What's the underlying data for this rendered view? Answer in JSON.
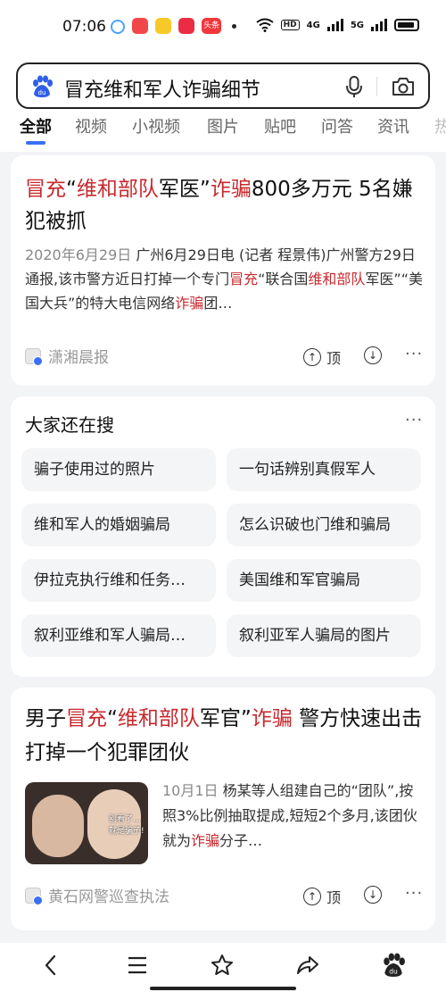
{
  "status": {
    "time": "07:06",
    "app5": "头条",
    "network": "4G",
    "network2": "5G",
    "hd": "HD"
  },
  "search": {
    "query": "冒充维和军人诈骗细节"
  },
  "tabs": [
    "全部",
    "视频",
    "小视频",
    "图片",
    "贴吧",
    "问答",
    "资讯",
    "热"
  ],
  "result1": {
    "title": [
      {
        "t": "冒充",
        "r": true
      },
      {
        "t": "“"
      },
      {
        "t": "维和部队",
        "r": true
      },
      {
        "t": "军医”"
      },
      {
        "t": "诈骗",
        "r": true
      },
      {
        "t": "800多万元 5名嫌犯被抓"
      }
    ],
    "date": "2020年6月29日",
    "snippet": [
      {
        "t": "  广州6月29日电 (记者 程景伟)广州警方29日通报,该市警方近日打掉一个专门"
      },
      {
        "t": "冒充",
        "r": true
      },
      {
        "t": "“联合国"
      },
      {
        "t": "维和部队",
        "r": true
      },
      {
        "t": "军医”“美国大兵”的特大电信网络"
      },
      {
        "t": "诈骗",
        "r": true
      },
      {
        "t": "团…"
      }
    ],
    "source": "潇湘晨报",
    "top_label": "顶",
    "more": "···"
  },
  "people_search": {
    "title": "大家还在搜",
    "more": "···",
    "items": [
      "骗子使用过的照片",
      "一句话辨别真假军人",
      "维和军人的婚姻骗局",
      "怎么识破也门维和骗局",
      "伊拉克执行维和任务…",
      "美国维和军官骗局",
      "叙利亚维和军人骗局…",
      "叙利亚军人骗局的图片"
    ]
  },
  "result2": {
    "title": [
      {
        "t": "男子"
      },
      {
        "t": "冒充",
        "r": true
      },
      {
        "t": "“"
      },
      {
        "t": "维和部队",
        "r": true
      },
      {
        "t": "军官”"
      },
      {
        "t": "诈骗",
        "r": true
      },
      {
        "t": " 警方快速出击打掉一个犯罪团伙"
      }
    ],
    "date": "10月1日",
    "snippet": [
      {
        "t": "  杨某等人组建自己的“团队”,按照3%比例抽取提成,短短2个多月,该团伙就为"
      },
      {
        "t": "诈骗",
        "r": true
      },
      {
        "t": "分子…"
      }
    ],
    "thumb_caption": "别看了…\n就是骗子!",
    "source": "黄石网警巡查执法",
    "top_label": "顶",
    "more": "···"
  },
  "colors": {
    "accent": "#3a6ff7",
    "highlight": "#c8292e"
  }
}
